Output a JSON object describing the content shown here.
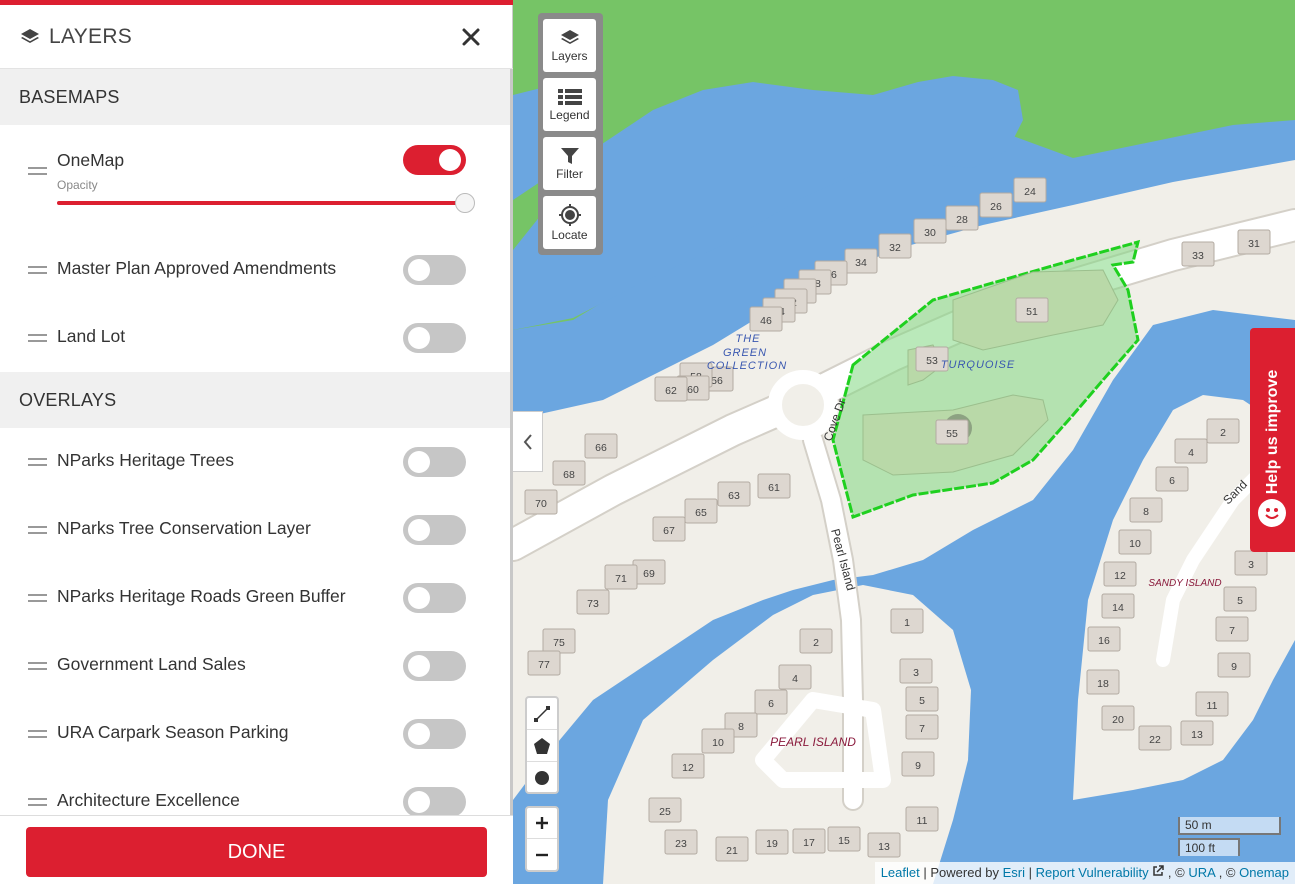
{
  "panel": {
    "title": "LAYERS",
    "basemaps_header": "BASEMAPS",
    "overlays_header": "OVERLAYS",
    "opacity_label": "Opacity",
    "opacity_value": 1.0,
    "basemaps": [
      {
        "label": "OneMap",
        "on": true
      },
      {
        "label": "Master Plan Approved Amendments",
        "on": false
      },
      {
        "label": "Land Lot",
        "on": false
      }
    ],
    "overlays": [
      {
        "label": "NParks Heritage Trees",
        "on": false
      },
      {
        "label": "NParks Tree Conservation Layer",
        "on": false
      },
      {
        "label": "NParks Heritage Roads Green Buffer",
        "on": false
      },
      {
        "label": "Government Land Sales",
        "on": false
      },
      {
        "label": "URA Carpark Season Parking",
        "on": false
      },
      {
        "label": "Architecture Excellence",
        "on": false
      }
    ],
    "done_label": "DONE"
  },
  "toolbar": {
    "layers": "Layers",
    "legend": "Legend",
    "filter": "Filter",
    "locate": "Locate"
  },
  "map": {
    "labels": {
      "the": "THE",
      "green": "GREEN",
      "collection": "COLLECTION",
      "turquoise": "TURQUOISE",
      "pearl_island": "PEARL ISLAND",
      "sandy_island": "SANDY ISLAND",
      "cove_dr": "Cove Dr",
      "pearl_island_road": "Pearl Island",
      "sandy_road": "Sand"
    },
    "lot_numbers": [
      "24",
      "26",
      "28",
      "30",
      "32",
      "34",
      "36",
      "38",
      "40",
      "42",
      "44",
      "46",
      "56",
      "58",
      "60",
      "62",
      "66",
      "68",
      "70",
      "61",
      "63",
      "65",
      "67",
      "69",
      "71",
      "73",
      "75",
      "77",
      "33",
      "31",
      "51",
      "53",
      "55",
      "2",
      "4",
      "6",
      "8",
      "10",
      "12",
      "25",
      "23",
      "21",
      "19",
      "17",
      "15",
      "13",
      "11",
      "9",
      "7",
      "5",
      "3",
      "1",
      "2",
      "4",
      "6",
      "8",
      "10",
      "12",
      "14",
      "16",
      "18",
      "20",
      "22",
      "13",
      "11",
      "9",
      "7",
      "5",
      "3"
    ],
    "scale_metric": "50 m",
    "scale_imperial": "100 ft",
    "colors": {
      "water": "#6ba6e0",
      "park": "#76c466",
      "highlight": "#1fd01f",
      "accent": "#dc1f30"
    }
  },
  "attribution": {
    "leaflet": "Leaflet",
    "powered": "| Powered by",
    "esri": "Esri",
    "sep1": "|",
    "report": "Report Vulnerability",
    "copy1": ", ©",
    "ura": "URA",
    "copy2": ", ©",
    "onemap": "Onemap"
  },
  "help": {
    "label": "Help us improve"
  }
}
